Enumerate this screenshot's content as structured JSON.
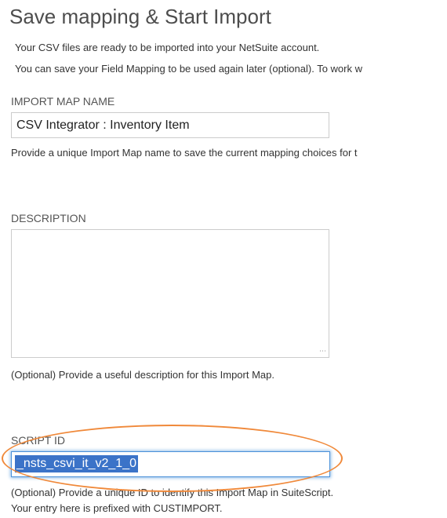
{
  "page": {
    "title": "Save mapping & Start Import",
    "intro_line1": "Your CSV files are ready to be imported into your NetSuite account.",
    "intro_line2": "You can save your Field Mapping to be used again later (optional). To work w"
  },
  "import_map_name": {
    "label": "IMPORT MAP NAME",
    "value": "CSV Integrator : Inventory Item",
    "help": "Provide a unique Import Map name to save the current mapping choices for t"
  },
  "description": {
    "label": "DESCRIPTION",
    "value": "",
    "help": "(Optional) Provide a useful description for this Import Map."
  },
  "script_id": {
    "label": "SCRIPT ID",
    "value": "_nsts_csvi_it_v2_1_0",
    "help_line1": "(Optional) Provide a unique ID to identify this Import Map in SuiteScript.",
    "help_line2": "Your entry here is prefixed with CUSTIMPORT."
  },
  "colors": {
    "highlight": "#f0893a",
    "selection": "#3b73c8",
    "focus_border": "#4a90d9"
  }
}
